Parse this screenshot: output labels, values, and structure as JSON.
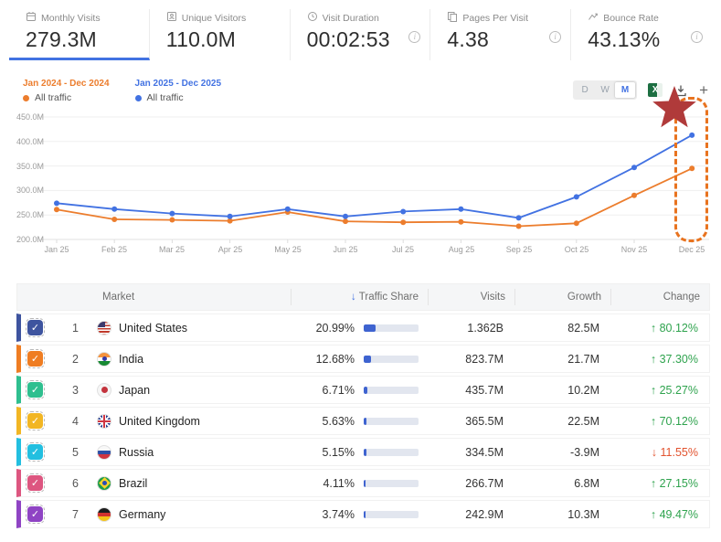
{
  "metrics": {
    "items": [
      {
        "label": "Monthly Visits",
        "value": "279.3M",
        "selected": true
      },
      {
        "label": "Unique Visitors",
        "value": "110.0M",
        "selected": false
      },
      {
        "label": "Visit Duration",
        "value": "00:02:53",
        "selected": false
      },
      {
        "label": "Pages Per Visit",
        "value": "4.38",
        "selected": false
      },
      {
        "label": "Bounce Rate",
        "value": "43.13%",
        "selected": false
      }
    ]
  },
  "chart": {
    "legend": [
      {
        "range": "Jan 2024 - Dec 2024",
        "series_label": "All traffic",
        "color": "#ec7d2d"
      },
      {
        "range": "Jan 2025 - Dec 2025",
        "series_label": "All traffic",
        "color": "#4272e2"
      }
    ],
    "granularity": {
      "day": "D",
      "week": "W",
      "month": "M",
      "selected": "M"
    },
    "y_labels": [
      "450.0M",
      "400.0M",
      "350.0M",
      "300.0M",
      "250.0M",
      "200.0M"
    ],
    "x_labels": [
      "Jan 25",
      "Feb 25",
      "Mar 25",
      "Apr 25",
      "May 25",
      "Jun 25",
      "Jul 25",
      "Aug 25",
      "Sep 25",
      "Oct 25",
      "Nov 25",
      "Dec 25"
    ]
  },
  "chart_data": {
    "type": "line",
    "title": "Monthly visits, all traffic, year-over-year comparison",
    "x": [
      "Jan 25",
      "Feb 25",
      "Mar 25",
      "Apr 25",
      "May 25",
      "Jun 25",
      "Jul 25",
      "Aug 25",
      "Sep 25",
      "Oct 25",
      "Nov 25",
      "Dec 25"
    ],
    "unit": "M visits",
    "ylim": [
      200,
      450
    ],
    "grid": true,
    "legend_position": "top-left",
    "series": [
      {
        "name": "Jan 2024 - Dec 2024 · All traffic",
        "color": "#ec7d2d",
        "values": [
          261,
          241,
          240,
          238,
          256,
          237,
          235,
          236,
          227,
          233,
          290,
          345
        ]
      },
      {
        "name": "Jan 2025 - Dec 2025 · All traffic",
        "color": "#4272e2",
        "values": [
          274,
          262,
          253,
          247,
          262,
          247,
          257,
          262,
          244,
          287,
          347,
          413
        ]
      }
    ]
  },
  "annotation": {
    "type": "star-and-dashed-box",
    "target": "Dec 25",
    "star_color": "#b03a3a",
    "box_color": "#e8731f"
  },
  "icons": {
    "sort_desc": "↓",
    "up_arrow": "↑",
    "down_arrow": "↓",
    "plus": "+",
    "excel": "X",
    "check": "✓",
    "info": "i"
  },
  "colors": {
    "accent_blue": "#4272e2",
    "series_blue": "#4272e2",
    "series_orange": "#ec7d2d",
    "positive": "#2fa34e",
    "negative": "#e2532f",
    "share_fill": "#3e63d0"
  },
  "table": {
    "headers": {
      "market": "Market",
      "traffic_share": "Traffic Share",
      "visits": "Visits",
      "growth": "Growth",
      "change": "Change"
    },
    "rows": [
      {
        "rank": "1",
        "market": "United States",
        "share": "20.99%",
        "visits": "1.362B",
        "growth": "82.5M",
        "arrow": "↑",
        "change": "80.12%",
        "change_color": "#2fa34e",
        "color": "#3e549f"
      },
      {
        "rank": "2",
        "market": "India",
        "share": "12.68%",
        "visits": "823.7M",
        "growth": "21.7M",
        "arrow": "↑",
        "change": "37.30%",
        "change_color": "#2fa34e",
        "color": "#ef7d22"
      },
      {
        "rank": "3",
        "market": "Japan",
        "share": "6.71%",
        "visits": "435.7M",
        "growth": "10.2M",
        "arrow": "↑",
        "change": "25.27%",
        "change_color": "#2fa34e",
        "color": "#2fbf8f"
      },
      {
        "rank": "4",
        "market": "United Kingdom",
        "share": "5.63%",
        "visits": "365.5M",
        "growth": "22.5M",
        "arrow": "↑",
        "change": "70.12%",
        "change_color": "#2fa34e",
        "color": "#f2b624"
      },
      {
        "rank": "5",
        "market": "Russia",
        "share": "5.15%",
        "visits": "334.5M",
        "growth": "-3.9M",
        "arrow": "↓",
        "change": "11.55%",
        "change_color": "#e2532f",
        "color": "#22bfe0"
      },
      {
        "rank": "6",
        "market": "Brazil",
        "share": "4.11%",
        "visits": "266.7M",
        "growth": "6.8M",
        "arrow": "↑",
        "change": "27.15%",
        "change_color": "#2fa34e",
        "color": "#dd5680"
      },
      {
        "rank": "7",
        "market": "Germany",
        "share": "3.74%",
        "visits": "242.9M",
        "growth": "10.3M",
        "arrow": "↑",
        "change": "49.47%",
        "change_color": "#2fa34e",
        "color": "#8f44c4"
      }
    ]
  }
}
